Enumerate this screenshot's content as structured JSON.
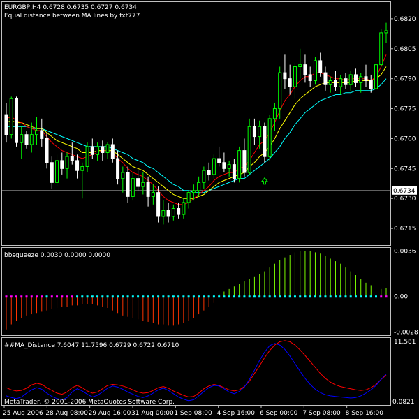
{
  "colors": {
    "background": "#000000",
    "frame": "#c0c0c0",
    "bull_candle": "#00ff00",
    "bear_candle": "#ffffff",
    "ma_fast": "#ff0000",
    "ma_mid": "#ffff00",
    "ma_slow": "#00ffff",
    "signal_arrow": "#00ff00",
    "squeeze_pos": "#7cfc00",
    "squeeze_neg": "#ff3300",
    "dot_on": "#ff00ff",
    "dot_off": "#00ffff",
    "dist_red": "#ff0000",
    "dist_blue": "#0000ff",
    "current_price_line": "#c0c0c0"
  },
  "header": {
    "symbol_line": "EURGBP,H4  0.6728 0.6735 0.6727 0.6734",
    "subtitle": "Equal distance between MA lines by fxt777"
  },
  "panels": {
    "squeeze_label": "bbsqueeze 0.0030 0.0000 0.0000",
    "distance_label": "##MA_Distance 7.6047 11.7596 0.6729 0.6722 0.6710",
    "copyright": "MetaTrader, © 2001-2006 MetaQuotes Software Corp."
  },
  "price_axis": {
    "ticks": [
      "0.6820",
      "0.6805",
      "0.6790",
      "0.6775",
      "0.6760",
      "0.6745",
      "0.6730",
      "0.6715"
    ],
    "current_price": "0.6734"
  },
  "squeeze_axis": {
    "ticks": [
      "0.0036",
      "0.00",
      "-0.0028"
    ]
  },
  "distance_axis": {
    "ticks": [
      "11.581",
      "0.0821"
    ]
  },
  "time_axis": {
    "labels": [
      "25 Aug 2006",
      "28 Aug 08:00",
      "29 Aug 16:00",
      "31 Aug 00:00",
      "1 Sep 08:00",
      "4 Sep 16:00",
      "6 Sep 00:00",
      "7 Sep 08:00",
      "8 Sep 16:00"
    ]
  },
  "chart_data": [
    {
      "type": "candlestick",
      "title": "EURGBP,H4",
      "ylim": [
        0.6707,
        0.6828
      ],
      "ohlc": [
        [
          0.6772,
          0.6778,
          0.6758,
          0.6762
        ],
        [
          0.6762,
          0.6781,
          0.676,
          0.678
        ],
        [
          0.678,
          0.6781,
          0.6756,
          0.6758
        ],
        [
          0.6758,
          0.6766,
          0.675,
          0.6762
        ],
        [
          0.6762,
          0.6764,
          0.6755,
          0.6757
        ],
        [
          0.6757,
          0.6768,
          0.6753,
          0.6762
        ],
        [
          0.6762,
          0.6771,
          0.6757,
          0.6764
        ],
        [
          0.6764,
          0.677,
          0.6756,
          0.676
        ],
        [
          0.676,
          0.6763,
          0.6745,
          0.6748
        ],
        [
          0.6748,
          0.6751,
          0.6735,
          0.6738
        ],
        [
          0.6738,
          0.6752,
          0.6736,
          0.6749
        ],
        [
          0.6749,
          0.6753,
          0.6742,
          0.6745
        ],
        [
          0.6745,
          0.6753,
          0.674,
          0.6751
        ],
        [
          0.6751,
          0.6758,
          0.6747,
          0.6749
        ],
        [
          0.6749,
          0.6752,
          0.674,
          0.6744
        ],
        [
          0.6744,
          0.6748,
          0.673,
          0.6746
        ],
        [
          0.6746,
          0.6758,
          0.6743,
          0.6756
        ],
        [
          0.6756,
          0.676,
          0.675,
          0.6752
        ],
        [
          0.6752,
          0.6758,
          0.6749,
          0.6756
        ],
        [
          0.6756,
          0.6759,
          0.6749,
          0.6753
        ],
        [
          0.6753,
          0.6758,
          0.675,
          0.6757
        ],
        [
          0.6757,
          0.676,
          0.6748,
          0.675
        ],
        [
          0.675,
          0.6754,
          0.6737,
          0.674
        ],
        [
          0.674,
          0.6746,
          0.6733,
          0.6743
        ],
        [
          0.6743,
          0.6746,
          0.6728,
          0.6731
        ],
        [
          0.6731,
          0.6743,
          0.6729,
          0.674
        ],
        [
          0.674,
          0.6744,
          0.6734,
          0.6736
        ],
        [
          0.6736,
          0.6743,
          0.6732,
          0.6738
        ],
        [
          0.6738,
          0.6741,
          0.6726,
          0.6731
        ],
        [
          0.6731,
          0.6737,
          0.6727,
          0.6733
        ],
        [
          0.6733,
          0.6736,
          0.6718,
          0.6721
        ],
        [
          0.6721,
          0.6729,
          0.6717,
          0.6724
        ],
        [
          0.6724,
          0.6728,
          0.6718,
          0.6721
        ],
        [
          0.6721,
          0.6727,
          0.6719,
          0.6725
        ],
        [
          0.6725,
          0.6728,
          0.672,
          0.6722
        ],
        [
          0.6722,
          0.673,
          0.672,
          0.6728
        ],
        [
          0.6728,
          0.6734,
          0.6725,
          0.6733
        ],
        [
          0.6733,
          0.6737,
          0.6729,
          0.6734
        ],
        [
          0.6734,
          0.6741,
          0.6731,
          0.6738
        ],
        [
          0.6738,
          0.6746,
          0.6735,
          0.6744
        ],
        [
          0.6744,
          0.6748,
          0.6739,
          0.6742
        ],
        [
          0.6742,
          0.6752,
          0.674,
          0.675
        ],
        [
          0.675,
          0.6756,
          0.6746,
          0.6748
        ],
        [
          0.6748,
          0.6753,
          0.6743,
          0.6745
        ],
        [
          0.6745,
          0.6749,
          0.6741,
          0.6747
        ],
        [
          0.6747,
          0.675,
          0.6738,
          0.674
        ],
        [
          0.674,
          0.6756,
          0.6738,
          0.6754
        ],
        [
          0.6754,
          0.676,
          0.6741,
          0.6743
        ],
        [
          0.6743,
          0.677,
          0.6742,
          0.6766
        ],
        [
          0.6766,
          0.677,
          0.6757,
          0.6761
        ],
        [
          0.6761,
          0.6769,
          0.6755,
          0.6766
        ],
        [
          0.6766,
          0.6768,
          0.6748,
          0.6751
        ],
        [
          0.6751,
          0.6772,
          0.6749,
          0.677
        ],
        [
          0.677,
          0.6778,
          0.6764,
          0.6775
        ],
        [
          0.6775,
          0.6796,
          0.677,
          0.6793
        ],
        [
          0.6793,
          0.6802,
          0.6785,
          0.679
        ],
        [
          0.679,
          0.6797,
          0.6782,
          0.6786
        ],
        [
          0.6786,
          0.6798,
          0.678,
          0.6796
        ],
        [
          0.6796,
          0.6805,
          0.679,
          0.6797
        ],
        [
          0.6797,
          0.6802,
          0.6788,
          0.6792
        ],
        [
          0.6792,
          0.6796,
          0.6786,
          0.6789
        ],
        [
          0.6789,
          0.6801,
          0.6787,
          0.6799
        ],
        [
          0.6799,
          0.6803,
          0.6791,
          0.6793
        ],
        [
          0.6793,
          0.6796,
          0.6784,
          0.6787
        ],
        [
          0.6787,
          0.6791,
          0.6783,
          0.6789
        ],
        [
          0.6789,
          0.6794,
          0.6784,
          0.6786
        ],
        [
          0.6786,
          0.6792,
          0.6782,
          0.679
        ],
        [
          0.679,
          0.6793,
          0.6785,
          0.6787
        ],
        [
          0.6787,
          0.6794,
          0.6784,
          0.6792
        ],
        [
          0.6792,
          0.6795,
          0.6786,
          0.6788
        ],
        [
          0.6788,
          0.6793,
          0.6783,
          0.6791
        ],
        [
          0.6791,
          0.6797,
          0.6786,
          0.6789
        ],
        [
          0.6789,
          0.6792,
          0.6783,
          0.6785
        ],
        [
          0.6785,
          0.6799,
          0.6784,
          0.6797
        ],
        [
          0.6797,
          0.6815,
          0.6796,
          0.6813
        ],
        [
          0.6813,
          0.6818,
          0.6808,
          0.6814
        ]
      ],
      "ma_fast": [
        0.677,
        0.6771,
        0.6769,
        0.6768,
        0.6766,
        0.6765,
        0.6764,
        0.6764,
        0.6761,
        0.6758,
        0.6756,
        0.6754,
        0.6753,
        0.6752,
        0.6751,
        0.675,
        0.6751,
        0.6752,
        0.6753,
        0.6754,
        0.6754,
        0.6753,
        0.675,
        0.6748,
        0.6745,
        0.6743,
        0.6742,
        0.6741,
        0.6739,
        0.6737,
        0.6734,
        0.6731,
        0.6729,
        0.6728,
        0.6727,
        0.6727,
        0.6728,
        0.673,
        0.6732,
        0.6734,
        0.6736,
        0.6739,
        0.6741,
        0.6742,
        0.6743,
        0.6743,
        0.6745,
        0.6746,
        0.6749,
        0.6753,
        0.6757,
        0.6759,
        0.6763,
        0.6768,
        0.6774,
        0.6779,
        0.6782,
        0.6786,
        0.6789,
        0.6791,
        0.6791,
        0.6793,
        0.6793,
        0.6792,
        0.6791,
        0.679,
        0.679,
        0.6789,
        0.679,
        0.679,
        0.679,
        0.679,
        0.6789,
        0.6791,
        0.6796,
        0.6802
      ],
      "ma_mid": [
        0.6768,
        0.6769,
        0.6768,
        0.6768,
        0.6767,
        0.6766,
        0.6765,
        0.6765,
        0.6763,
        0.6761,
        0.6759,
        0.6758,
        0.6757,
        0.6756,
        0.6755,
        0.6753,
        0.6753,
        0.6753,
        0.6754,
        0.6754,
        0.6754,
        0.6754,
        0.6752,
        0.675,
        0.6748,
        0.6746,
        0.6745,
        0.6744,
        0.6742,
        0.674,
        0.6738,
        0.6736,
        0.6734,
        0.6732,
        0.6731,
        0.673,
        0.673,
        0.673,
        0.6731,
        0.6732,
        0.6734,
        0.6736,
        0.6738,
        0.6739,
        0.674,
        0.6741,
        0.6742,
        0.6743,
        0.6746,
        0.6748,
        0.6751,
        0.6753,
        0.6756,
        0.676,
        0.6765,
        0.6769,
        0.6773,
        0.6777,
        0.678,
        0.6782,
        0.6784,
        0.6786,
        0.6787,
        0.6788,
        0.6788,
        0.6788,
        0.6788,
        0.6788,
        0.6788,
        0.6789,
        0.6789,
        0.6789,
        0.6789,
        0.679,
        0.6792,
        0.6796
      ],
      "ma_slow": [
        0.6766,
        0.6766,
        0.6766,
        0.6766,
        0.6766,
        0.6765,
        0.6765,
        0.6765,
        0.6764,
        0.6763,
        0.6762,
        0.6761,
        0.676,
        0.6759,
        0.6758,
        0.6757,
        0.6756,
        0.6756,
        0.6756,
        0.6756,
        0.6756,
        0.6755,
        0.6754,
        0.6753,
        0.6752,
        0.675,
        0.6749,
        0.6748,
        0.6746,
        0.6745,
        0.6743,
        0.6741,
        0.6739,
        0.6737,
        0.6736,
        0.6734,
        0.6734,
        0.6733,
        0.6733,
        0.6733,
        0.6734,
        0.6735,
        0.6736,
        0.6737,
        0.6738,
        0.6739,
        0.674,
        0.674,
        0.6742,
        0.6744,
        0.6746,
        0.6748,
        0.675,
        0.6753,
        0.6756,
        0.676,
        0.6763,
        0.6767,
        0.677,
        0.6773,
        0.6775,
        0.6777,
        0.6779,
        0.678,
        0.6781,
        0.6782,
        0.6782,
        0.6783,
        0.6783,
        0.6784,
        0.6784,
        0.6784,
        0.6784,
        0.6785,
        0.6787,
        0.679
      ],
      "arrow_index": 51
    },
    {
      "type": "bar",
      "title": "bbsqueeze 0.0030 0.0000 0.0000",
      "ylim": [
        -0.003,
        0.0038
      ],
      "values": [
        -0.0026,
        -0.0022,
        -0.0019,
        -0.0017,
        -0.0015,
        -0.0014,
        -0.0013,
        -0.0012,
        -0.0011,
        -0.001,
        -0.0009,
        -0.0008,
        -0.0008,
        -0.0007,
        -0.0007,
        -0.0006,
        -0.0006,
        -0.0006,
        -0.0007,
        -0.0008,
        -0.0009,
        -0.0011,
        -0.0013,
        -0.0015,
        -0.0016,
        -0.0017,
        -0.0018,
        -0.0019,
        -0.002,
        -0.0021,
        -0.0022,
        -0.0022,
        -0.0023,
        -0.0023,
        -0.0022,
        -0.0021,
        -0.0019,
        -0.0017,
        -0.0014,
        -0.0011,
        -0.0008,
        -0.0005,
        0.0002,
        0.0004,
        0.0006,
        0.0008,
        0.001,
        0.0012,
        0.0014,
        0.0016,
        0.0018,
        0.002,
        0.0023,
        0.0026,
        0.0029,
        0.0031,
        0.0033,
        0.0035,
        0.0036,
        0.0036,
        0.0036,
        0.0035,
        0.0034,
        0.0032,
        0.003,
        0.0028,
        0.0026,
        0.0023,
        0.002,
        0.0017,
        0.0014,
        0.0011,
        0.0009,
        0.0007,
        0.0006,
        0.0007
      ],
      "dots_on": [
        1,
        1,
        1,
        1,
        1,
        1,
        1,
        1,
        0,
        1,
        1,
        1,
        1,
        1,
        0,
        0,
        0,
        0,
        0,
        0,
        0,
        0,
        0,
        0,
        0,
        0,
        0,
        0,
        0,
        0,
        0,
        0,
        0,
        0,
        0,
        0,
        0,
        0,
        0,
        0,
        0,
        0,
        0,
        0,
        0,
        0,
        0,
        0,
        0,
        0,
        0,
        0,
        0,
        0,
        0,
        0,
        0,
        0,
        0,
        0,
        0,
        0,
        0,
        0,
        0,
        0,
        0,
        0,
        0,
        0,
        0,
        0,
        0,
        0,
        1,
        1
      ]
    },
    {
      "type": "line",
      "title": "##MA_Distance 7.6047 11.7596 0.6729 0.6722 0.6710",
      "ylim": [
        0.0821,
        11.581
      ],
      "series": [
        {
          "color": "#ff0000",
          "values": [
            3.0,
            2.6,
            2.4,
            2.5,
            2.9,
            3.5,
            3.8,
            3.6,
            3.0,
            2.5,
            2.0,
            1.8,
            2.2,
            3.0,
            3.4,
            3.0,
            2.4,
            2.0,
            2.2,
            2.8,
            3.4,
            3.6,
            3.5,
            3.3,
            3.0,
            2.6,
            2.2,
            2.0,
            2.1,
            2.5,
            3.0,
            3.2,
            2.9,
            2.4,
            2.0,
            1.6,
            1.3,
            1.4,
            2.0,
            2.8,
            3.3,
            3.6,
            3.4,
            3.0,
            2.6,
            2.4,
            2.6,
            3.2,
            4.2,
            5.6,
            7.0,
            8.5,
            9.8,
            10.8,
            11.4,
            11.6,
            11.4,
            10.8,
            9.9,
            8.9,
            7.8,
            6.7,
            5.6,
            4.7,
            4.0,
            3.5,
            3.2,
            3.0,
            2.8,
            2.6,
            2.5,
            2.6,
            3.0,
            3.6,
            4.5,
            5.3
          ]
        },
        {
          "color": "#0000ff",
          "values": [
            1.5,
            1.2,
            1.0,
            1.3,
            2.0,
            2.6,
            3.0,
            2.7,
            2.0,
            1.4,
            1.0,
            0.8,
            1.2,
            2.2,
            2.8,
            2.4,
            1.8,
            1.3,
            1.6,
            2.2,
            2.9,
            3.3,
            3.1,
            2.7,
            2.2,
            1.8,
            1.4,
            1.2,
            1.5,
            2.0,
            2.6,
            2.9,
            2.5,
            1.9,
            1.3,
            0.9,
            0.6,
            0.8,
            1.5,
            2.3,
            3.0,
            3.4,
            3.3,
            2.8,
            2.2,
            1.9,
            2.3,
            3.1,
            4.5,
            6.2,
            8.0,
            9.5,
            10.7,
            11.1,
            10.8,
            10.0,
            8.8,
            7.4,
            6.0,
            4.7,
            3.6,
            2.7,
            2.1,
            1.7,
            1.5,
            1.4,
            1.3,
            1.2,
            1.1,
            1.2,
            1.5,
            2.0,
            2.6,
            3.4,
            4.5,
            5.5
          ]
        }
      ]
    }
  ]
}
